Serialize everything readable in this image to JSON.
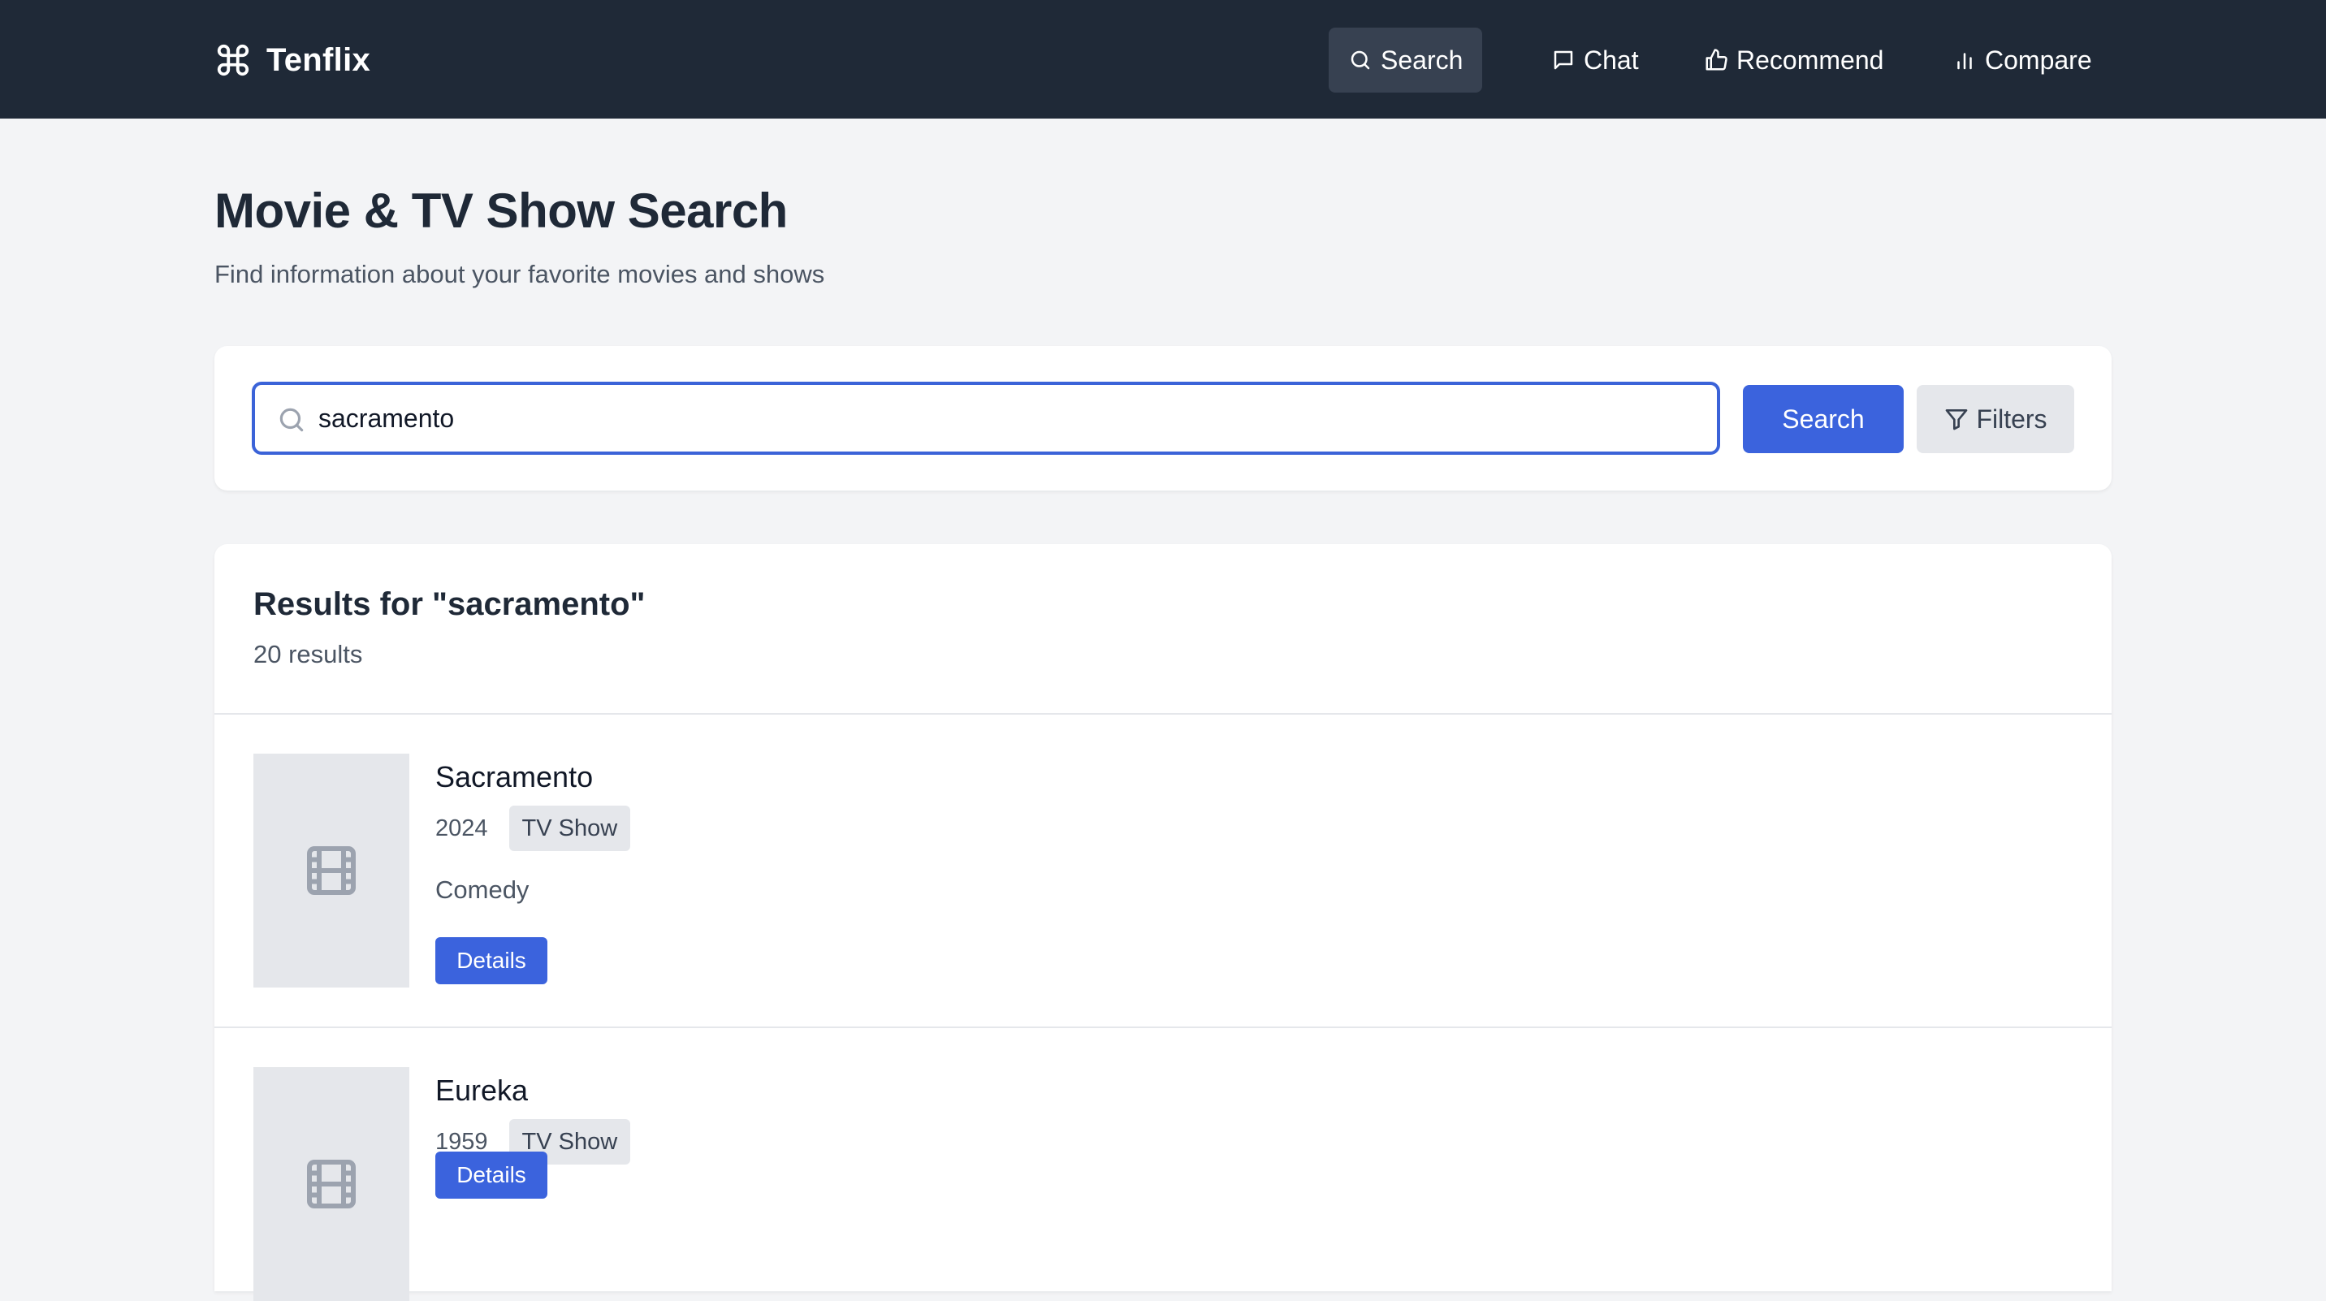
{
  "nav": {
    "brand": "Tenflix",
    "items": [
      {
        "label": "Search",
        "icon": "search-icon",
        "active": true
      },
      {
        "label": "Chat",
        "icon": "chat-icon",
        "active": false
      },
      {
        "label": "Recommend",
        "icon": "thumbs-up-icon",
        "active": false
      },
      {
        "label": "Compare",
        "icon": "bar-chart-icon",
        "active": false
      }
    ]
  },
  "page": {
    "title": "Movie & TV Show Search",
    "subtitle": "Find information about your favorite movies and shows"
  },
  "search": {
    "value": "sacramento",
    "button_label": "Search",
    "filters_label": "Filters"
  },
  "results": {
    "title": "Results for \"sacramento\"",
    "count": "20 results",
    "items": [
      {
        "title": "Sacramento",
        "year": "2024",
        "type": "TV Show",
        "genre": "Comedy",
        "details_label": "Details"
      },
      {
        "title": "Eureka",
        "year": "1959",
        "type": "TV Show",
        "genre": "",
        "details_label": "Details"
      }
    ]
  },
  "colors": {
    "navbar": "#1f2937",
    "accent": "#3b63dd",
    "page_bg": "#f3f4f6"
  }
}
